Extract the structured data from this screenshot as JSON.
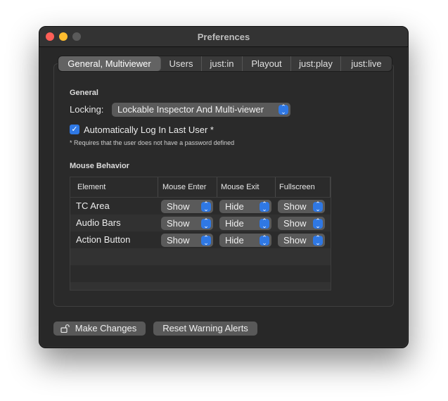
{
  "window": {
    "title": "Preferences"
  },
  "tabs": [
    {
      "label": "General, Multiviewer",
      "active": true
    },
    {
      "label": "Users",
      "active": false
    },
    {
      "label": "just:in",
      "active": false
    },
    {
      "label": "Playout",
      "active": false
    },
    {
      "label": "just:play",
      "active": false
    },
    {
      "label": "just:live",
      "active": false
    }
  ],
  "general": {
    "section_title": "General",
    "locking_label": "Locking:",
    "locking_value": "Lockable Inspector And Multi-viewer",
    "auto_login_label": "Automatically Log In Last User *",
    "auto_login_checked": true,
    "note": "* Requires that the user does not have a password defined"
  },
  "mouse_behavior": {
    "section_title": "Mouse Behavior",
    "columns": [
      "Element",
      "Mouse Enter",
      "Mouse Exit",
      "Fullscreen"
    ],
    "rows": [
      {
        "element": "TC Area",
        "enter": "Show",
        "exit": "Hide",
        "fullscreen": "Show"
      },
      {
        "element": "Audio Bars",
        "enter": "Show",
        "exit": "Hide",
        "fullscreen": "Show"
      },
      {
        "element": "Action Button",
        "enter": "Show",
        "exit": "Hide",
        "fullscreen": "Show"
      }
    ]
  },
  "buttons": {
    "make_changes": "Make Changes",
    "reset_alerts": "Reset Warning Alerts"
  },
  "colors": {
    "accent": "#2f78e4",
    "window_bg": "#282828",
    "control_bg": "#5a5a5a"
  }
}
